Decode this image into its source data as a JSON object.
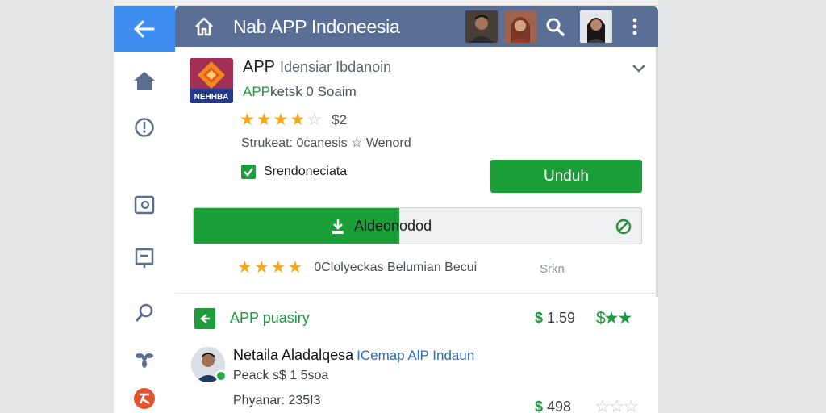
{
  "appbar": {
    "title": "Nab APP Indoneesia"
  },
  "app": {
    "logo_text": "NEHHBA",
    "name": "APP",
    "name_sub": "Idensiar Ibdanoin",
    "dev_prefix": "APP",
    "dev_rest": "ketsk 0 Soaim",
    "rating_stars": 4,
    "rating_label": "$2",
    "meta": "Strukeat: 0canesis ☆ Wenord"
  },
  "install": {
    "checkbox_label": "Srendoneciata",
    "button_label": "Unduh",
    "progress_label": "Aldeonodod",
    "progress_fraction": 0.46
  },
  "rating_row": {
    "stars": 4,
    "text": "0Clolyeckas Belumian Becui",
    "side": "Srkn"
  },
  "section": {
    "title": "APP puasiry",
    "price": "1.59",
    "price_symbol": "$"
  },
  "review": {
    "name": "Netaila Aladalqesa",
    "tag": "ICemap AlP Indaun",
    "line1": "Peack s$ 1 5soa",
    "line2": "Phyanar: 235I3",
    "price": "498",
    "price_symbol": "$"
  },
  "colors": {
    "accent_green": "#1a9e38",
    "appbar": "#5a6f96",
    "back_blue": "#3d8ef0",
    "star": "#f3a81b"
  }
}
